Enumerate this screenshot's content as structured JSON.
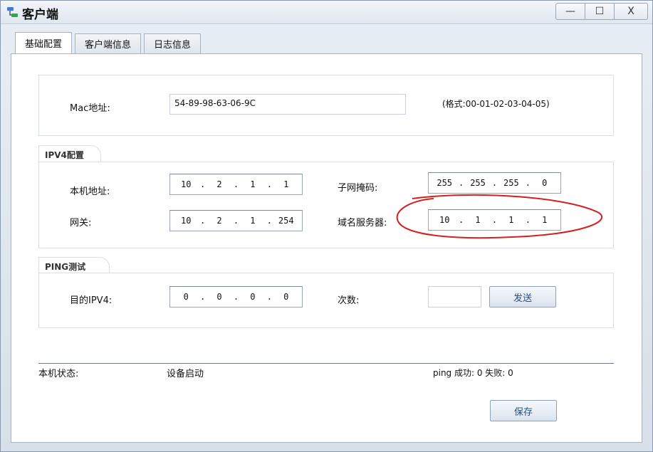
{
  "window": {
    "title": "客户端",
    "controls": {
      "minimize": "—",
      "maximize": "☐",
      "close": "X"
    }
  },
  "tabs": [
    {
      "label": "基础配置",
      "active": true
    },
    {
      "label": "客户端信息",
      "active": false
    },
    {
      "label": "日志信息",
      "active": false
    }
  ],
  "mac": {
    "label": "Mac地址:",
    "value": "54-89-98-63-06-9C",
    "hint": "(格式:00-01-02-03-04-05)"
  },
  "ipv4": {
    "section_title": "IPV4配置",
    "local_addr_label": "本机地址:",
    "local_addr": [
      "10",
      "2",
      "1",
      "1"
    ],
    "subnet_label": "子网掩码:",
    "subnet": [
      "255",
      "255",
      "255",
      "0"
    ],
    "gateway_label": "网关:",
    "gateway": [
      "10",
      "2",
      "1",
      "254"
    ],
    "dns_label": "域名服务器:",
    "dns": [
      "10",
      "1",
      "1",
      "1"
    ]
  },
  "ping": {
    "section_title": "PING测试",
    "dest_label": "目的IPV4:",
    "dest": [
      "0",
      "0",
      "0",
      "0"
    ],
    "count_label": "次数:",
    "count_value": "",
    "send_button": "发送"
  },
  "status": {
    "label": "本机状态:",
    "value": "设备启动",
    "ping_result": "ping 成功: 0 失败: 0"
  },
  "save_button": "保存",
  "colors": {
    "annotation": "#d42020",
    "button_text": "#2b4f7a",
    "titlebar": "#e6edf5"
  },
  "icons": {
    "app": "network-client-icon"
  }
}
